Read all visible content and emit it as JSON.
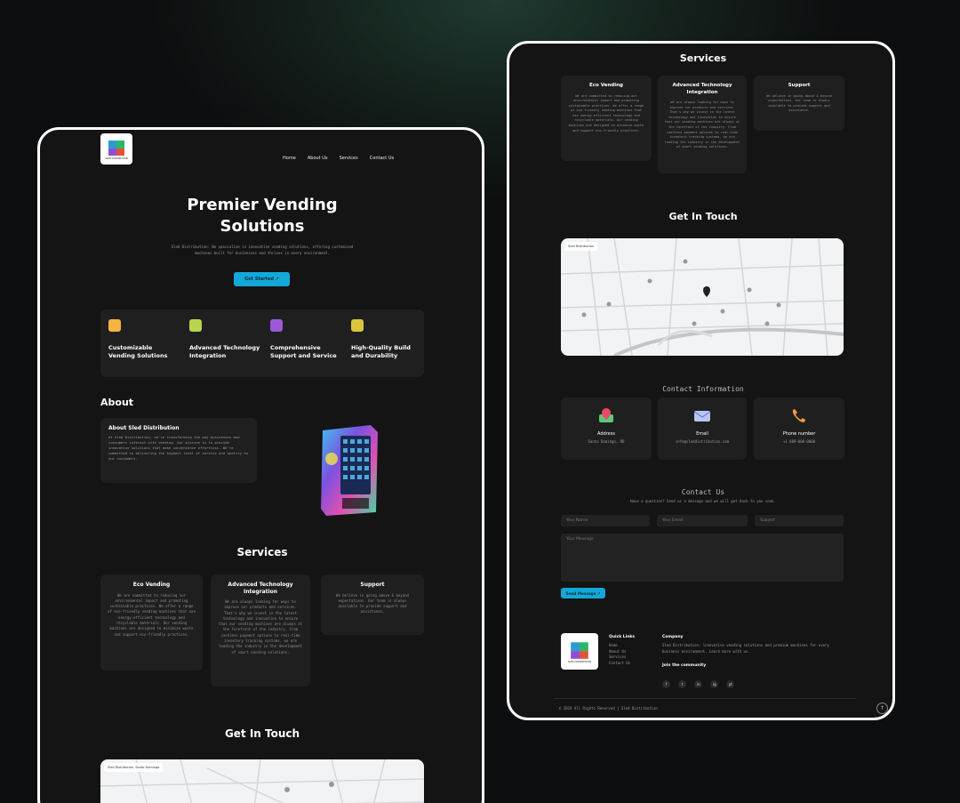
{
  "left": {
    "logo_text": "SLED DISTRIBUTION",
    "nav": [
      "Home",
      "About Us",
      "Services",
      "Contact Us"
    ],
    "hero": {
      "title_line1": "Premier Vending",
      "title_line2": "Solutions",
      "subtitle": "Sled Distribution: We specialize in innovative vending solutions, offering customized machines built for businesses and thrives in every environment.",
      "cta": "Get Started ↗"
    },
    "features": [
      {
        "icon": "vending-card-icon",
        "color": "#f5b342",
        "title": "Customizable Vending Solutions"
      },
      {
        "icon": "tech-chip-icon",
        "color": "#b8d44a",
        "title": "Advanced Technology Integration"
      },
      {
        "icon": "support-icon",
        "color": "#9b59d6",
        "title": "Comprehensive Support and Service"
      },
      {
        "icon": "quality-icon",
        "color": "#d9c53a",
        "title": "High-Quality Build and Durability"
      }
    ],
    "about": {
      "heading": "About",
      "card_title": "About Sled Distribution",
      "card_text": "At Sled Distribution, we're transforming the way businesses and consumers interact with vending. Our mission is to provide innovative solutions that make convenience effortless. We're committed to delivering the highest level of service and quality to our customers."
    },
    "services_heading": "Services",
    "services": [
      {
        "title": "Eco Vending",
        "desc": "We are committed to reducing our environmental impact and promoting sustainable practices. We offer a range of eco-friendly vending machines that use energy-efficient technology and recyclable materials. Our vending machines are designed to minimize waste and support eco-friendly practices."
      },
      {
        "title": "Advanced Technology Integration",
        "desc": "We are always looking for ways to improve our products and services. That's why we invest in the latest technology and innovation to ensure that our vending machines are always at the forefront of the industry. From cashless payment options to real-time inventory tracking systems, we are leading the industry in the development of smart vending solutions."
      },
      {
        "title": "Support",
        "desc": "We believe in going above & beyond expectations. Our team is always available to provide support and assistance."
      }
    ],
    "touch_heading": "Get In Touch",
    "map_label": "Sled Distribution, Santo Domingo"
  },
  "right": {
    "services_heading": "Services",
    "services": [
      {
        "title": "Eco Vending",
        "desc": "We are committed to reducing our environmental impact and promoting sustainable practices. We offer a range of eco-friendly vending machines that use energy-efficient technology and recyclable materials. Our vending machines are designed to minimize waste and support eco-friendly practices."
      },
      {
        "title": "Advanced Technology Integration",
        "desc": "We are always looking for ways to improve our products and services. That's why we invest in the latest technology and innovation to ensure that our vending machines are always at the forefront of the industry. From cashless payment options to real-time inventory tracking systems, we are leading the industry in the development of smart vending solutions."
      },
      {
        "title": "Support",
        "desc": "We believe in going above & beyond expectations. Our team is always available to provide support and assistance."
      }
    ],
    "touch_heading": "Get In Touch",
    "map_label": "Sled Distribution",
    "contact_info_heading": "Contact Information",
    "contact_cards": [
      {
        "icon": "location-pin-icon",
        "title": "Address",
        "value": "Santo Domingo, RD"
      },
      {
        "icon": "envelope-icon",
        "title": "Email",
        "value": "info@sleddistribution.com"
      },
      {
        "icon": "phone-icon",
        "title": "Phone number",
        "value": "+1 809-000-0000"
      }
    ],
    "contact_us_heading": "Contact Us",
    "contact_us_sub": "Have a question? Send us a message and we will get back to you soon.",
    "form": {
      "name_placeholder": "Your Name",
      "email_placeholder": "Your Email",
      "subject_placeholder": "Subject",
      "message_placeholder": "Your Message",
      "submit": "Send Message ↗"
    },
    "footer": {
      "logo_text": "SLED DISTRIBUTION",
      "quick_links_heading": "Quick Links",
      "quick_links": [
        "Home",
        "About Us",
        "Services",
        "Contact Us"
      ],
      "company_heading": "Company",
      "company_text": "Sled Distribution: innovative vending solutions and premium machines for every business environment. Learn more with us.",
      "community_heading": "Join the community",
      "socials": [
        "f",
        "t",
        "in",
        "ig",
        "yt"
      ],
      "copyright": "© 2024 All Rights Reserved | Sled Distribution"
    }
  },
  "colors": {
    "accent": "#12a9d9",
    "card": "#1f1f1f",
    "panel": "#141414"
  }
}
